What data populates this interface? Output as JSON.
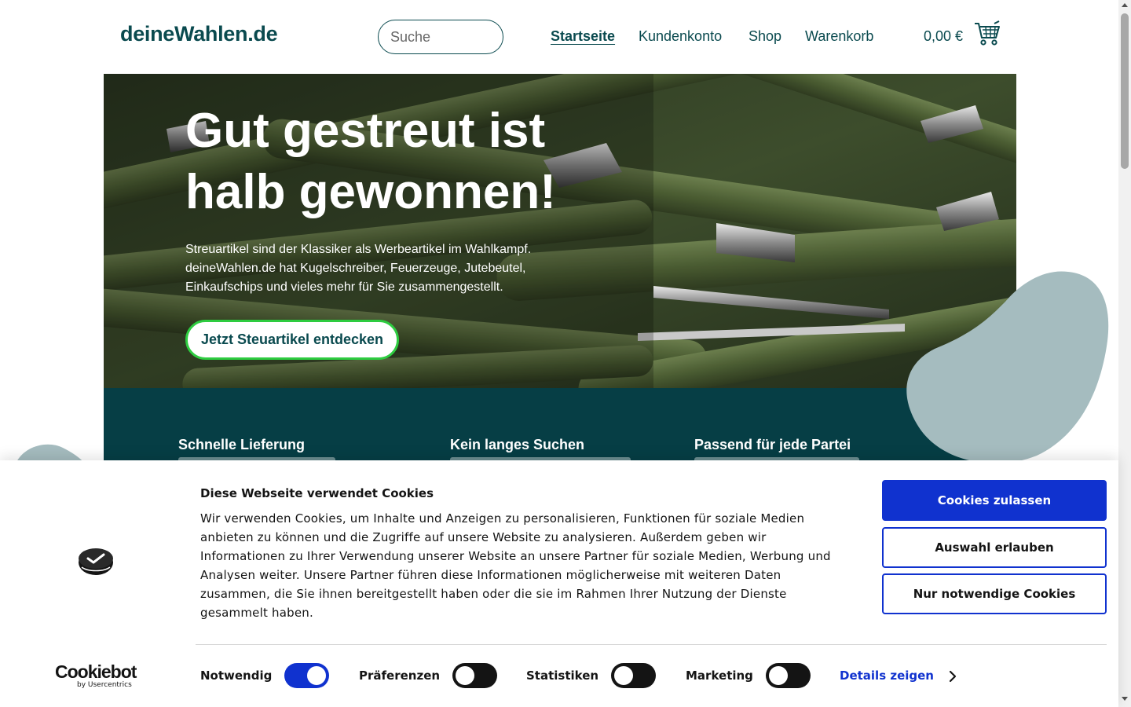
{
  "header": {
    "logo": "deineWahlen.de",
    "search_placeholder": "Suche",
    "nav": [
      {
        "label": "Startseite",
        "active": true
      },
      {
        "label": "Kundenkonto",
        "active": false
      },
      {
        "label": "Shop",
        "active": false
      },
      {
        "label": "Warenkorb",
        "active": false
      }
    ],
    "cart_total": "0,00 €",
    "cart_icon": "shopping-cart-icon"
  },
  "hero": {
    "title": "Gut gestreut ist halb gewonnen!",
    "text": "Streuartikel sind der Klassiker als Werbeartikel im Wahlkampf. deineWahlen.de hat Kugelschreiber, Feuerzeuge, Jutebeutel, Einkaufschips und vieles mehr für Sie zusammengestellt.",
    "button": "Jetzt Steuartikel entdecken"
  },
  "features": [
    {
      "title": "Schnelle Lieferung"
    },
    {
      "title": "Kein langes Suchen"
    },
    {
      "title": "Passend für jede Partei"
    }
  ],
  "cookie_banner": {
    "title": "Diese Webseite verwendet Cookies",
    "text": "Wir verwenden Cookies, um Inhalte und Anzeigen zu personalisieren, Funktionen für soziale Medien anbieten zu können und die Zugriffe auf unsere Website zu analysieren. Außerdem geben wir Informationen zu Ihrer Verwendung unserer Website an unsere Partner für soziale Medien, Werbung und Analysen weiter. Unsere Partner führen diese Informationen möglicherweise mit weiteren Daten zusammen, die Sie ihnen bereitgestellt haben oder die sie im Rahmen Ihrer Nutzung der Dienste gesammelt haben.",
    "buttons": {
      "allow_all": "Cookies zulassen",
      "allow_selection": "Auswahl erlauben",
      "necessary_only": "Nur notwendige Cookies"
    },
    "toggles": [
      {
        "label": "Notwendig",
        "on": true
      },
      {
        "label": "Präferenzen",
        "on": false
      },
      {
        "label": "Statistiken",
        "on": false
      },
      {
        "label": "Marketing",
        "on": false
      }
    ],
    "details_link": "Details zeigen",
    "brand": {
      "name": "Cookiebot",
      "sub": "by Usercentrics"
    }
  },
  "colors": {
    "brand": "#0a4a4f",
    "band": "#063e45",
    "accent_green": "#2ecc40",
    "cookie_blue": "#1032cf",
    "blob": "#a5bcbf"
  }
}
